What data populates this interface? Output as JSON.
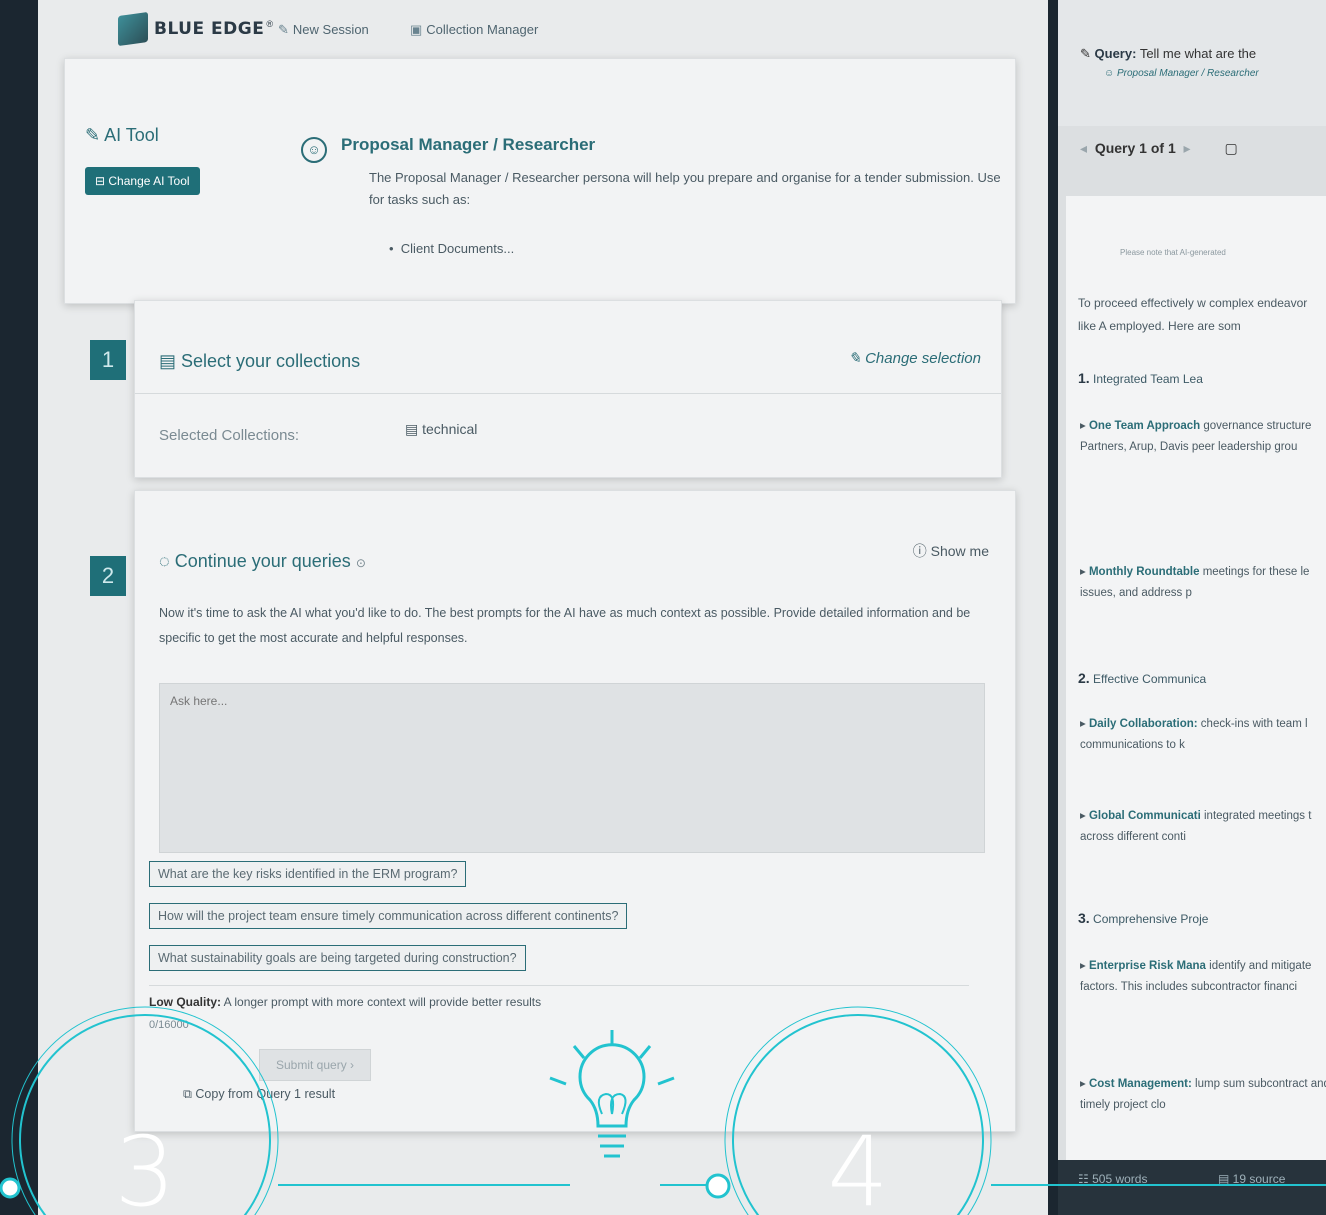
{
  "header": {
    "logo_text": "BLUE EDGE",
    "logo_mark": "®",
    "new_session": "New Session",
    "collection_manager": "Collection Manager"
  },
  "ai_tool": {
    "title": "AI Tool",
    "change_button": "Change AI Tool",
    "persona_title": "Proposal Manager / Researcher",
    "persona_description": "The Proposal Manager / Researcher persona will help you prepare and organise for a tender submission. Use for tasks such as:",
    "persona_bullet": "Client Documents..."
  },
  "step1": {
    "number": "1",
    "heading": "Select your collections",
    "change_selection": "Change selection",
    "selected_label": "Selected Collections:",
    "selected_value": "technical"
  },
  "step2": {
    "number": "2",
    "heading": "Continue your queries",
    "show_me": "Show me",
    "description": "Now it's time to ask the AI what you'd like to do. The best prompts for the AI have as much context as possible. Provide detailed information and be specific to get the most accurate and helpful responses.",
    "input_placeholder": "Ask here...",
    "suggestions": [
      "What are the key risks identified in the ERM program?",
      "How will the project team ensure timely communication across different continents?",
      "What sustainability goals are being targeted during construction?"
    ],
    "quality_label": "Low Quality:",
    "quality_text": "A longer prompt with more context will provide better results",
    "counter": "0/16000",
    "submit_button": "Submit query",
    "copy_from": "Copy from Query 1 result"
  },
  "right_panel": {
    "query_label": "Query:",
    "query_text": "Tell me what are the",
    "persona": "Proposal Manager / Researcher",
    "pager": "Query 1 of 1",
    "disclaimer": "Please note that AI-generated",
    "intro": "To proceed effectively w complex endeavor like A employed. Here are som",
    "sections": [
      {
        "num": "1.",
        "title": "Integrated Team Lea"
      },
      {
        "num": "2.",
        "title": "Effective Communica"
      },
      {
        "num": "3.",
        "title": "Comprehensive Proje"
      }
    ],
    "items": [
      {
        "title": "One Team Approach",
        "text": "governance structure Partners, Arup, Davis peer leadership grou"
      },
      {
        "title": "Monthly Roundtable",
        "text": "meetings for these le issues, and address p"
      },
      {
        "title": "Daily Collaboration:",
        "text": "check-ins with team l communications to k"
      },
      {
        "title": "Global Communicati",
        "text": "integrated meetings t across different conti"
      },
      {
        "title": "Enterprise Risk Mana",
        "text": "identify and mitigate factors. This includes subcontractor financi"
      },
      {
        "title": "Cost Management:",
        "text": "lump sum subcontract and timely project clo"
      }
    ],
    "word_count": "505 words",
    "sources": "19 source"
  },
  "overlay": {
    "step_left": "3",
    "step_right": "4"
  },
  "colors": {
    "accent": "#1f6f78",
    "overlay_line": "#22c3cf"
  }
}
